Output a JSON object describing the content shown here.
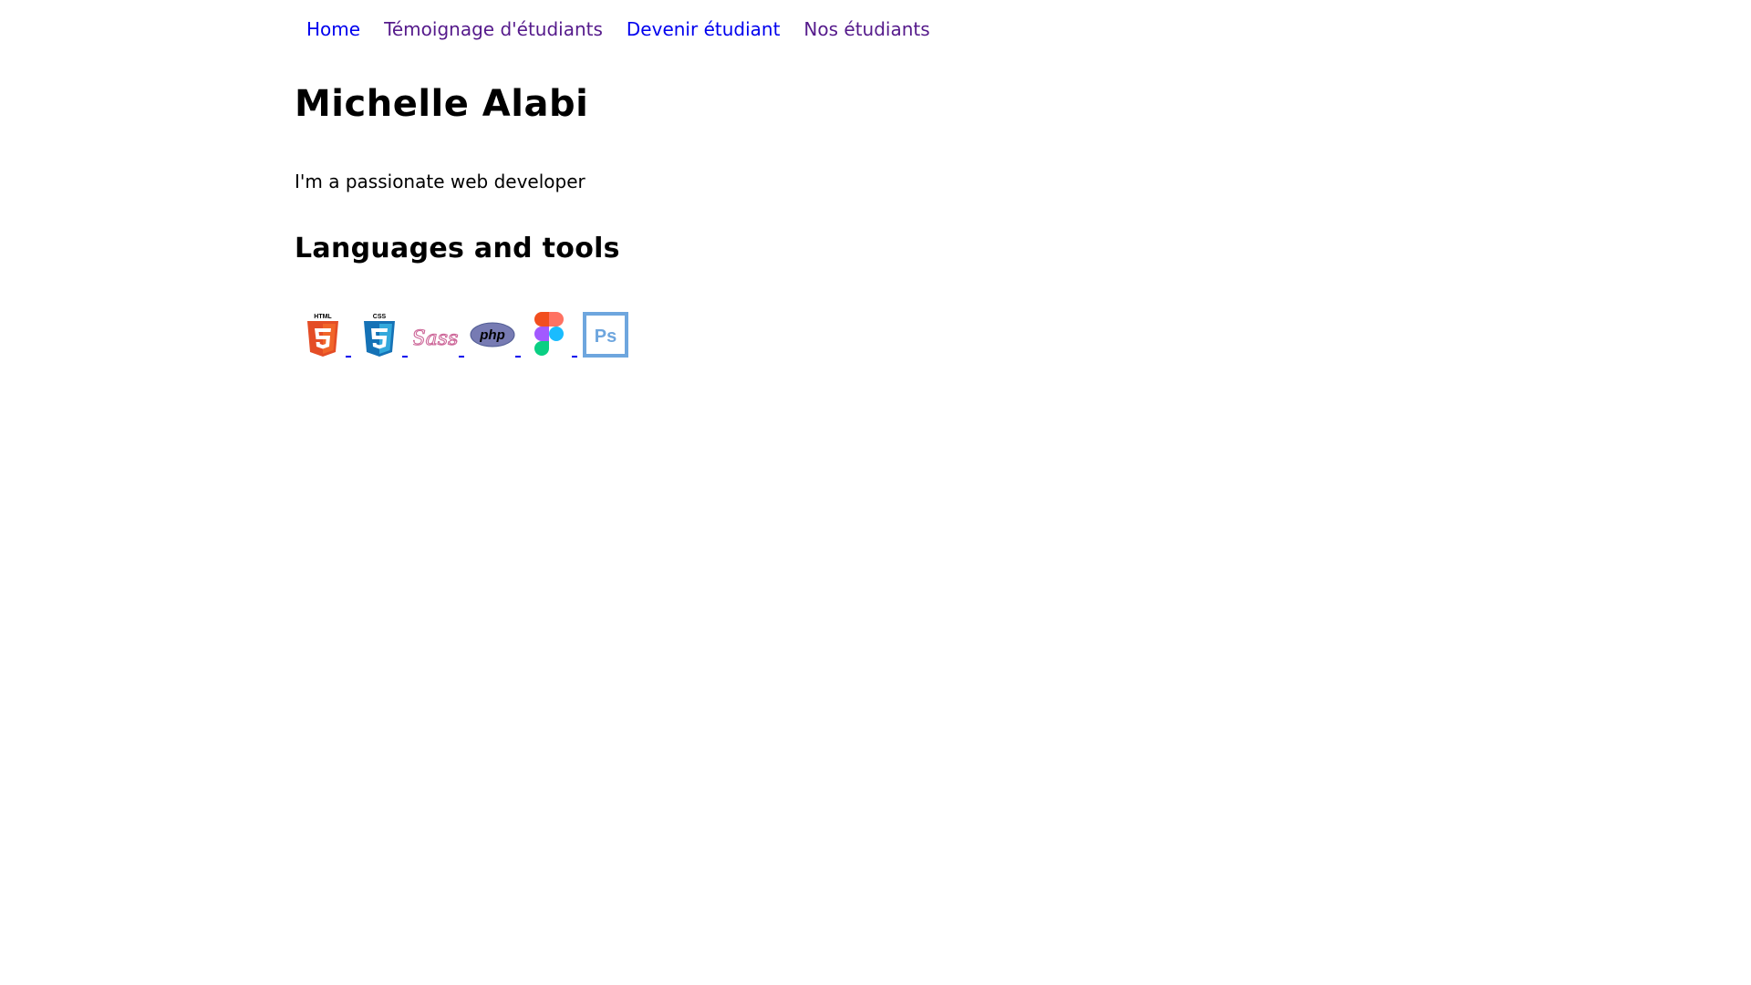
{
  "nav": {
    "items": [
      {
        "label": "Home",
        "state": "new"
      },
      {
        "label": "Témoignage d'étudiants",
        "state": "visited"
      },
      {
        "label": "Devenir étudiant",
        "state": "new"
      },
      {
        "label": "Nos étudiants",
        "state": "visited"
      }
    ]
  },
  "profile": {
    "name": "Michelle Alabi",
    "tagline": "I'm a passionate web developer"
  },
  "tools": {
    "heading": "Languages and tools",
    "icons": [
      {
        "icon": "html5-icon",
        "label": "HTML"
      },
      {
        "icon": "css3-icon",
        "label": "CSS"
      },
      {
        "icon": "sass-icon",
        "label": "Sass"
      },
      {
        "icon": "php-icon",
        "label": "php"
      },
      {
        "icon": "figma-icon"
      },
      {
        "icon": "photoshop-icon",
        "label": "Ps"
      }
    ]
  },
  "colors": {
    "link": "#0000ee",
    "link_visited": "#551a8b",
    "html5": "#e44d26",
    "css3": "#1572b6",
    "sass": "#cd6799",
    "php": "#777bb3",
    "photoshop": "#6ea6de"
  }
}
